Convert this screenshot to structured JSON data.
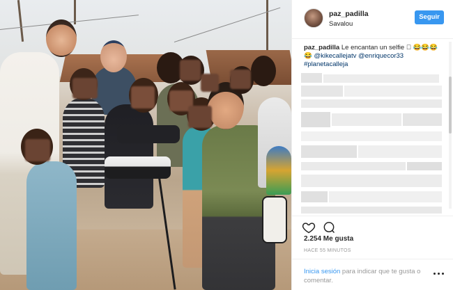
{
  "post": {
    "username": "paz_padilla",
    "location": "Savalou",
    "follow_label": "Seguir"
  },
  "caption": {
    "user": "paz_padilla",
    "text": "Le encantan un selfie \u0000 😂😂😂",
    "line2_emoji": "😂",
    "mention1": "@kikecallejatv",
    "mention2": "@enriquecor33",
    "hashtag": "#planetacalleja"
  },
  "engagement": {
    "likes": "2.254 Me gusta",
    "time": "HACE 55 MINUTOS"
  },
  "footer": {
    "login_link": "Inicia sesión",
    "login_text": " para indicar que te gusta o comentar."
  },
  "icons": {
    "like": "heart-icon",
    "comment": "comment-icon",
    "more": "more-options-icon"
  },
  "colors": {
    "accent": "#3897f0",
    "tag": "#003569",
    "muted": "#999999"
  }
}
